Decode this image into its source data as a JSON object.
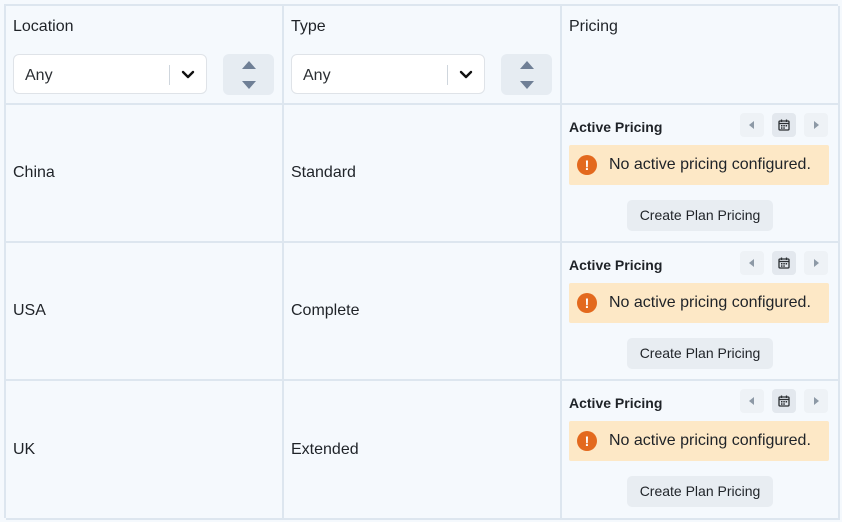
{
  "columns": {
    "location": {
      "label": "Location",
      "filter_value": "Any"
    },
    "type": {
      "label": "Type",
      "filter_value": "Any"
    },
    "pricing": {
      "label": "Pricing"
    }
  },
  "rows": [
    {
      "location": "China",
      "type": "Standard",
      "pricing_title": "Active Pricing",
      "alert": "No active pricing configured.",
      "action": "Create Plan Pricing"
    },
    {
      "location": "USA",
      "type": "Complete",
      "pricing_title": "Active Pricing",
      "alert": "No active pricing configured.",
      "action": "Create Plan Pricing"
    },
    {
      "location": "UK",
      "type": "Extended",
      "pricing_title": "Active Pricing",
      "alert": "No active pricing configured.",
      "action": "Create Plan Pricing"
    }
  ],
  "icons": {
    "alert": "exclamation-icon",
    "calendar": "calendar-icon",
    "prev": "caret-left-icon",
    "next": "caret-right-icon",
    "select": "chevron-down-icon",
    "sort": "sort-arrows-icon"
  },
  "colors": {
    "alert_bg": "#fde8c6",
    "alert_icon": "#e3691e",
    "background": "#f5f9fd",
    "border": "#dde6ef"
  }
}
